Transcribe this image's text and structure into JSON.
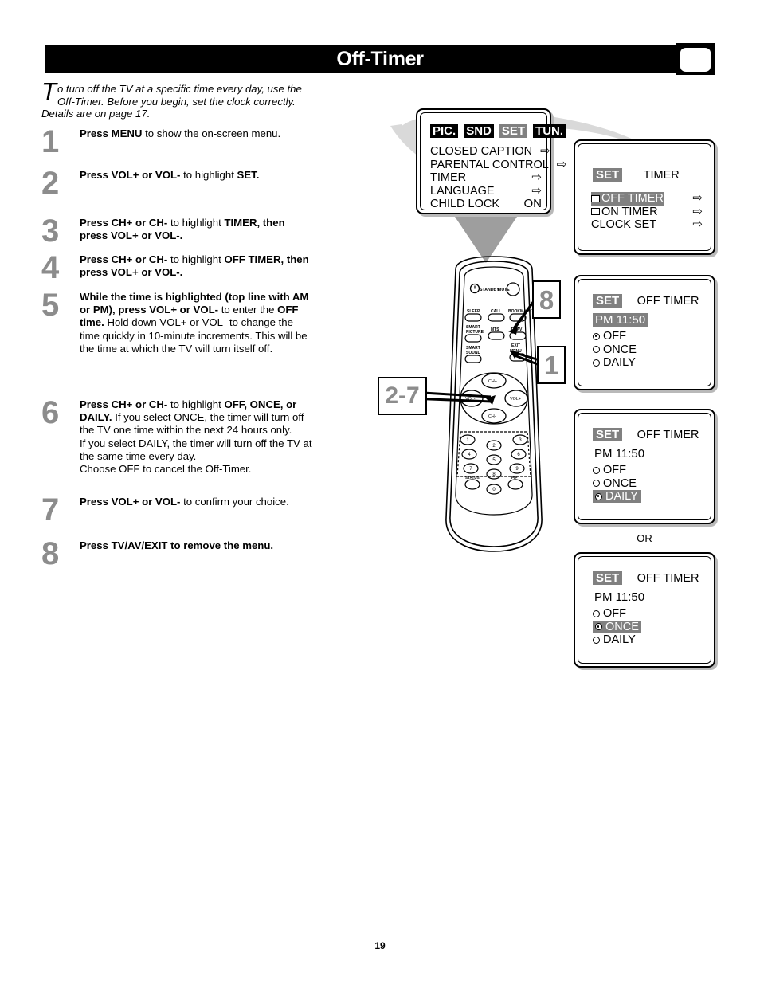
{
  "header": {
    "title": "Off-Timer",
    "icon": "tv-screen-icon"
  },
  "intro": {
    "dropcap": "T",
    "text": "o turn off the TV at a specific time every day, use the Off-Timer. Before you begin, set the clock correctly.  Details are on page 17."
  },
  "steps": [
    {
      "num": "1",
      "html": "<b>Press MENU</b> to show the on-screen menu."
    },
    {
      "num": "2",
      "html": "<b>Press VOL+ or VOL-</b> to highlight <b>SET.</b>"
    },
    {
      "num": "3",
      "html": "<b>Press CH+ or CH-</b> to highlight <b>TIMER, then press VOL+ or VOL-.</b>"
    },
    {
      "num": "4",
      "html": "<b>Press CH+ or CH-</b> to highlight <b>OFF TIMER, then press  VOL+ or VOL-.</b>"
    },
    {
      "num": "5",
      "html": "<b>While the time is highlighted (top line with AM or PM), press  VOL+ or VOL-</b> to enter the <b>OFF time.</b> Hold down VOL+ or VOL- to change the time quickly in 10-minute increments. This will be the time at which the TV will turn itself off."
    },
    {
      "num": "6",
      "html": "<b>Press CH+ or CH-</b> to highlight <b>OFF, ONCE, or DAILY.</b>  If you select ONCE, the timer will turn off the TV one time within the next 24 hours only.<br>If you select DAILY, the timer will turn off the TV at the same time every day.<br>Choose OFF to cancel the Off-Timer."
    },
    {
      "num": "7",
      "html": "<b>Press VOL+ or VOL-</b> to confirm your choice."
    },
    {
      "num": "8",
      "html": "<b>Press TV/AV/EXIT to remove the menu.</b>"
    }
  ],
  "osd_screens": {
    "main_menu": {
      "tabs": [
        {
          "label": "PIC.",
          "selected": false
        },
        {
          "label": "SND",
          "selected": false
        },
        {
          "label": "SET",
          "selected": true
        },
        {
          "label": "TUN.",
          "selected": false
        }
      ],
      "rows": [
        {
          "label": "CLOSED CAPTION",
          "value": "⇨"
        },
        {
          "label": "PARENTAL CONTROL",
          "value": "⇨"
        },
        {
          "label": "TIMER",
          "value": "⇨"
        },
        {
          "label": "LANGUAGE",
          "value": "⇨"
        },
        {
          "label": "CHILD LOCK",
          "value": "ON"
        }
      ]
    },
    "timer_menu": {
      "badge": "SET",
      "title": "TIMER",
      "rows": [
        {
          "label": "OFF TIMER",
          "value": "⇨",
          "checkbox": true,
          "highlighted": true
        },
        {
          "label": "ON TIMER",
          "value": "⇨",
          "checkbox": true,
          "highlighted": false
        },
        {
          "label": "CLOCK SET",
          "value": "⇨",
          "checkbox": false,
          "highlighted": false
        }
      ]
    },
    "off_timer_time": {
      "badge": "SET",
      "title": "OFF TIMER",
      "time": "PM 11:50",
      "time_highlighted": true,
      "options": [
        {
          "label": "OFF",
          "selected": true,
          "highlighted": false
        },
        {
          "label": "ONCE",
          "selected": false,
          "highlighted": false
        },
        {
          "label": "DAILY",
          "selected": false,
          "highlighted": false
        }
      ]
    },
    "off_timer_daily": {
      "badge": "SET",
      "title": "OFF TIMER",
      "time": "PM 11:50",
      "time_highlighted": false,
      "options": [
        {
          "label": "OFF",
          "selected": false,
          "highlighted": false
        },
        {
          "label": "ONCE",
          "selected": false,
          "highlighted": false
        },
        {
          "label": "DAILY",
          "selected": true,
          "highlighted": true
        }
      ]
    },
    "off_timer_once": {
      "badge": "SET",
      "title": "OFF TIMER",
      "time": "PM 11:50",
      "time_highlighted": false,
      "options": [
        {
          "label": "OFF",
          "selected": false,
          "highlighted": false
        },
        {
          "label": "ONCE",
          "selected": true,
          "highlighted": true
        },
        {
          "label": "DAILY",
          "selected": false,
          "highlighted": false
        }
      ]
    },
    "or_label": "OR"
  },
  "remote": {
    "top_buttons": [
      {
        "label": "STANDBY"
      },
      {
        "label": "MUTE"
      }
    ],
    "function_buttons": [
      {
        "label": "SLEEP"
      },
      {
        "label": "CALL"
      },
      {
        "label": "BOOKMARK"
      },
      {
        "label": "SMART PICTURE"
      },
      {
        "label": "MTS"
      },
      {
        "label": "TV/AV"
      },
      {
        "label": "SMART SOUND"
      },
      {
        "label": "EXIT MENU"
      }
    ],
    "dpad": [
      {
        "label": "CH+"
      },
      {
        "label": "VOL-"
      },
      {
        "label": "VOL+"
      },
      {
        "label": "CH-"
      }
    ],
    "keypad": [
      "1",
      "2",
      "3",
      "4",
      "5",
      "6",
      "7",
      "8",
      "9",
      "0"
    ],
    "keypad_side": [
      "STATUS",
      "PIP"
    ]
  },
  "callouts": [
    {
      "label": "8"
    },
    {
      "label": "1"
    },
    {
      "label": "2-7"
    }
  ],
  "page_number": "19",
  "colors": {
    "gray_number": "#8c8c8c",
    "highlight_gray": "#808080",
    "swoosh_gray": "#d6d6d6",
    "black": "#000000"
  }
}
